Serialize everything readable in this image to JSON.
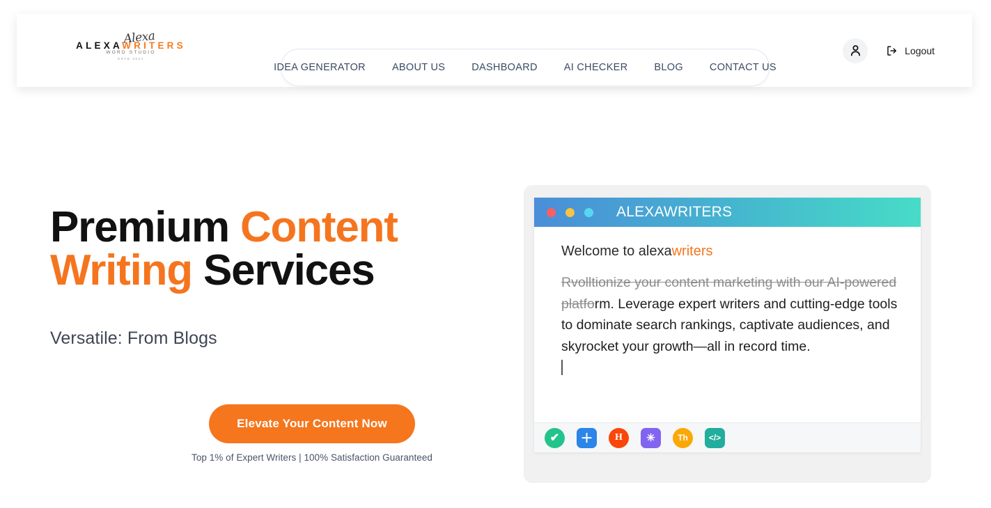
{
  "header": {
    "logo": {
      "script": "Alexa",
      "name_dark": "ALEXA",
      "name_accent": "WRITERS",
      "subtitle": "WORD STUDIO",
      "established": "ESTD 2021"
    },
    "nav": [
      {
        "label": "IDEA GENERATOR",
        "name": "idea-generator"
      },
      {
        "label": "ABOUT US",
        "name": "about-us"
      },
      {
        "label": "DASHBOARD",
        "name": "dashboard"
      },
      {
        "label": "AI CHECKER",
        "name": "ai-checker"
      },
      {
        "label": "BLOG",
        "name": "blog"
      },
      {
        "label": "CONTACT US",
        "name": "contact-us"
      }
    ],
    "account": {
      "avatar_icon": "user-icon",
      "logout_icon": "logout-icon",
      "logout_label": "Logout"
    }
  },
  "hero": {
    "title_line1_a": "Premium ",
    "title_line1_b": "Content",
    "title_line2_a": "Writing",
    "title_line2_b": " Services",
    "subtitle": "Versatile: From Blogs",
    "cta_label": "Elevate Your Content Now",
    "cta_note": "Top 1% of Expert Writers | 100% Satisfaction Guaranteed"
  },
  "mockup": {
    "title": "ALEXAWRITERS",
    "traffic_lights": [
      "red",
      "yellow",
      "blue"
    ],
    "welcome_plain": "Welcome to alexa",
    "welcome_accent": "writers",
    "body_struck": "Rvolltionize your content marketing with our AI-powered platfo",
    "body_rest": "rm. Leverage expert writers and cutting-edge tools to dominate search rankings, captivate audiences, and skyrocket your growth—all in record time.",
    "toolbar": [
      {
        "name": "spellcheck-icon",
        "glyph": "✔",
        "color": "#23c48c",
        "shape": "circle",
        "font_size": "16px"
      },
      {
        "name": "add-icon",
        "glyph": "＋",
        "color": "#2c85e8",
        "shape": "square",
        "font_size": "18px"
      },
      {
        "name": "heading-icon",
        "glyph": "H",
        "color": "#fa4608",
        "shape": "circle",
        "font_size": "14px"
      },
      {
        "name": "sparkle-icon",
        "glyph": "✳",
        "color": "#8264f0",
        "shape": "square",
        "font_size": "15px"
      },
      {
        "name": "thesaurus-icon",
        "glyph": "Th",
        "color": "#fba806",
        "shape": "circle",
        "font_size": "12px"
      },
      {
        "name": "code-icon",
        "glyph": "</>",
        "color": "#22ad9d",
        "shape": "square",
        "font_size": "12px"
      }
    ]
  },
  "colors": {
    "accent_orange": "#f5751f",
    "titlebar_start": "#4a8ed8",
    "titlebar_end": "#47dcc7"
  }
}
